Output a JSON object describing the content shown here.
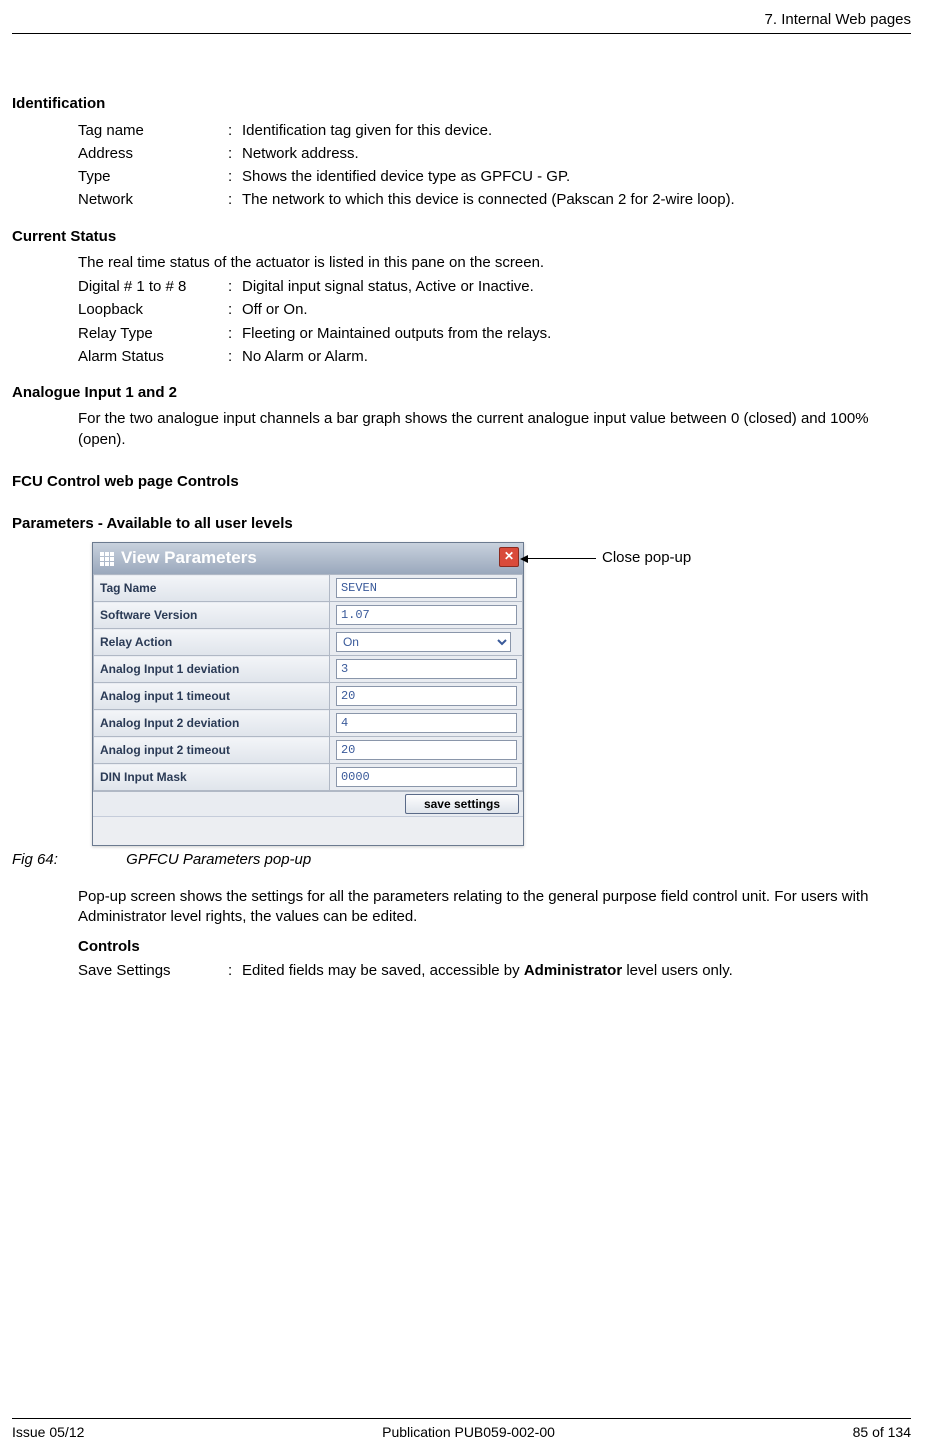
{
  "header": {
    "right_text": "7. Internal Web pages"
  },
  "section_identification": {
    "title": "Identification",
    "rows": [
      {
        "term": "Tag name",
        "desc": "Identification tag given for this device."
      },
      {
        "term": "Address",
        "desc": "Network address."
      },
      {
        "term": "Type",
        "desc": "Shows the identified device type as GPFCU - GP."
      },
      {
        "term": "Network",
        "desc": "The network to which this device is connected (Pakscan 2 for 2-wire loop)."
      }
    ]
  },
  "section_current_status": {
    "title": "Current Status",
    "intro": "The real time status of the actuator is listed in this pane on the screen.",
    "rows": [
      {
        "term": "Digital # 1 to # 8",
        "desc": "Digital input signal status, Active or Inactive."
      },
      {
        "term": "Loopback",
        "desc": "Off or On."
      },
      {
        "term": "Relay Type",
        "desc": "Fleeting or Maintained outputs from the relays."
      },
      {
        "term": "Alarm Status",
        "desc": "No Alarm or Alarm."
      }
    ]
  },
  "section_analogue": {
    "title": "Analogue Input 1 and 2",
    "text": "For the two analogue input channels a bar graph shows the current analogue input value between 0 (closed) and 100% (open)."
  },
  "section_fcu": {
    "title": "FCU Control web page Controls",
    "subtitle": "Parameters - Available to all user levels"
  },
  "popup": {
    "title": "View Parameters",
    "params": [
      {
        "label": "Tag Name",
        "value": "SEVEN",
        "type": "text"
      },
      {
        "label": "Software Version",
        "value": "1.07",
        "type": "text"
      },
      {
        "label": "Relay Action",
        "value": "On",
        "type": "select",
        "options": [
          "On"
        ]
      },
      {
        "label": "Analog Input 1 deviation",
        "value": "3",
        "type": "text"
      },
      {
        "label": "Analog input 1 timeout",
        "value": "20",
        "type": "text"
      },
      {
        "label": "Analog Input 2 deviation",
        "value": "4",
        "type": "text"
      },
      {
        "label": "Analog input 2 timeout",
        "value": "20",
        "type": "text"
      },
      {
        "label": "DIN Input Mask",
        "value": "0000",
        "type": "text"
      }
    ],
    "save_label": "save settings"
  },
  "annotation": {
    "close_popup": "Close pop-up"
  },
  "figure": {
    "num": "Fig 64:",
    "caption": "GPFCU Parameters pop-up"
  },
  "post_popup_para": "Pop-up screen shows the settings for all the parameters relating to the general purpose field control unit. For users with Administrator level rights, the values can be edited.",
  "section_controls": {
    "title": "Controls",
    "rows": [
      {
        "term": "Save Settings",
        "desc_prefix": "Edited fields may be saved, accessible by ",
        "desc_bold": "Administrator",
        "desc_suffix": " level users only."
      }
    ]
  },
  "footer": {
    "left": "Issue 05/12",
    "center": "Publication PUB059-002-00",
    "right": "85 of 134"
  }
}
